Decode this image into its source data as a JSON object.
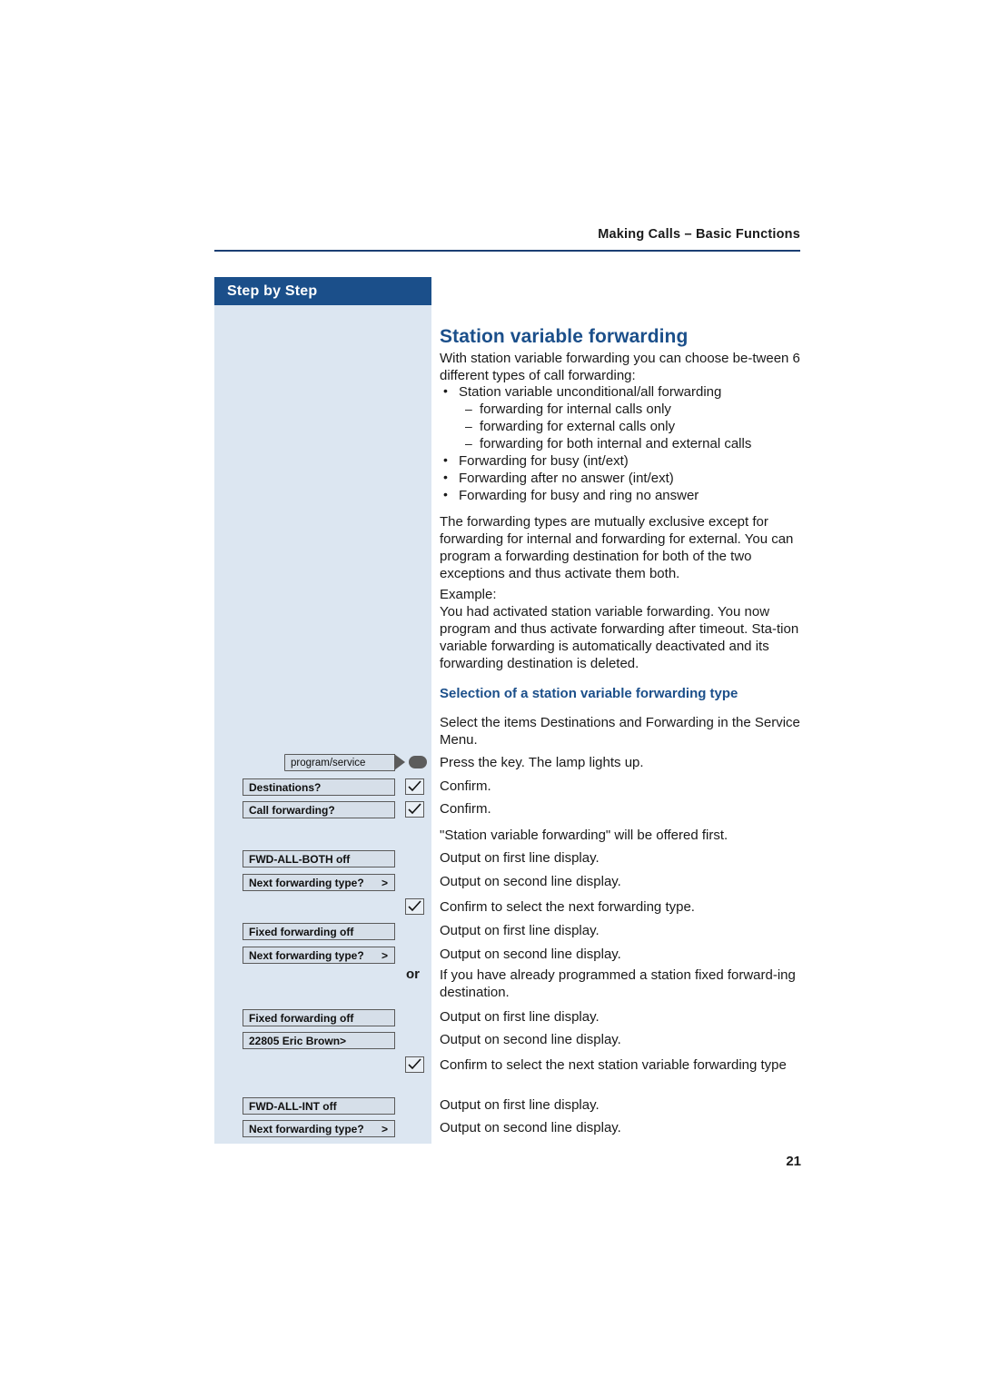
{
  "header": {
    "running_head": "Making Calls – Basic Functions",
    "page_number": "21"
  },
  "sidebar": {
    "title": "Step by Step"
  },
  "main": {
    "title": "Station variable forwarding",
    "intro": "With station variable forwarding you can choose be-tween 6 different types of call forwarding:",
    "bullets": [
      {
        "level": "bullet",
        "text": "Station variable unconditional/all forwarding"
      },
      {
        "level": "dash",
        "text": "forwarding for internal calls only"
      },
      {
        "level": "dash",
        "text": "forwarding for external calls only"
      },
      {
        "level": "dash",
        "text": "forwarding for both internal and external calls"
      },
      {
        "level": "bullet",
        "text": "Forwarding for busy (int/ext)"
      },
      {
        "level": "bullet",
        "text": "Forwarding after no answer (int/ext)"
      },
      {
        "level": "bullet",
        "text": "Forwarding for busy and ring no answer"
      }
    ],
    "mutual_exclusive": "The forwarding types are mutually exclusive except for forwarding for internal and forwarding for external. You can program a forwarding destination for both of the two exceptions and thus activate them both.",
    "example_label": "Example:",
    "example_text": "You had activated station variable forwarding. You now program and thus activate forwarding after timeout. Sta-tion variable forwarding is automatically deactivated and its forwarding destination is deleted.",
    "subhead": "Selection of a station variable forwarding type",
    "select_text": "Select the items Destinations and Forwarding in the Service Menu.",
    "steps": [
      {
        "key": "program/service",
        "text": "Press the key. The lamp lights up."
      },
      {
        "key": "Destinations?",
        "text": "Confirm."
      },
      {
        "key": "Call forwarding?",
        "text": "Confirm."
      },
      {
        "key": "",
        "text": "\"Station variable forwarding\" will be offered first."
      },
      {
        "key": "FWD-ALL-BOTH off",
        "text": "Output on first line display."
      },
      {
        "key": "Next forwarding type?",
        "text": "Output on second line display."
      },
      {
        "key": "",
        "text": "Confirm to select the next forwarding type."
      },
      {
        "key": "Fixed forwarding off",
        "text": "Output on first line display."
      },
      {
        "key": "Next forwarding type?",
        "text": "Output on second line display."
      },
      {
        "key": "",
        "or": "or",
        "text": "If you have already programmed a station fixed forward-ing destination."
      },
      {
        "key": "Fixed forwarding off",
        "text": "Output on first line display."
      },
      {
        "key": "22805 Eric Brown>",
        "text": "Output on second line display."
      },
      {
        "key": "",
        "text": "Confirm to select the next station variable forwarding type"
      },
      {
        "key": "FWD-ALL-INT off",
        "text": "Output on first line display."
      },
      {
        "key": "Next forwarding type?",
        "text": "Output on second line display."
      }
    ],
    "icons": {
      "confirm": "checkmark-icon",
      "lamp": "lamp-indicator-icon"
    }
  }
}
